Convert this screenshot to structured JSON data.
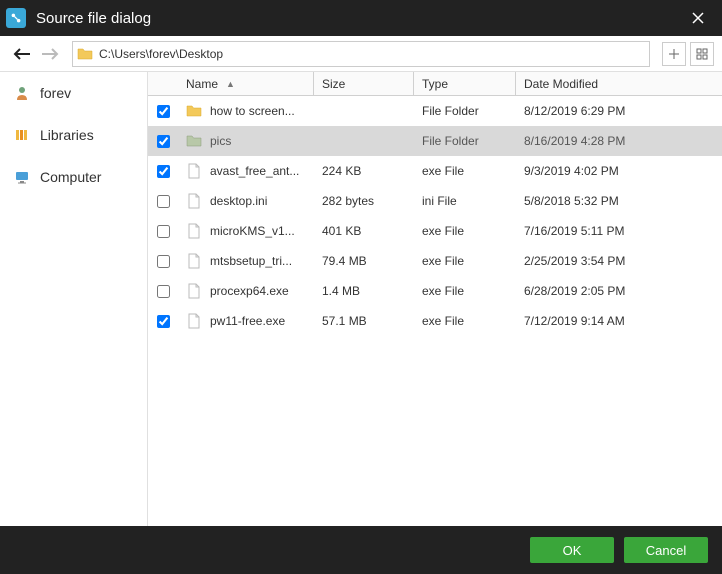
{
  "title": "Source file dialog",
  "path": "C:\\Users\\forev\\Desktop",
  "sidebar": {
    "items": [
      {
        "label": "forev",
        "iconColor": "#6fa27a"
      },
      {
        "label": "Libraries",
        "iconColor": "#f0b840"
      },
      {
        "label": "Computer",
        "iconColor": "#4a9fd8"
      }
    ]
  },
  "columns": {
    "name": "Name",
    "size": "Size",
    "type": "Type",
    "modified": "Date Modified"
  },
  "files": [
    {
      "checked": true,
      "kind": "folder",
      "name": "how to screen...",
      "size": "",
      "type": "File Folder",
      "modified": "8/12/2019 6:29 PM",
      "selected": false
    },
    {
      "checked": true,
      "kind": "folder",
      "name": "pics",
      "size": "",
      "type": "File Folder",
      "modified": "8/16/2019 4:28 PM",
      "selected": true
    },
    {
      "checked": true,
      "kind": "file",
      "name": "avast_free_ant...",
      "size": "224 KB",
      "type": "exe File",
      "modified": "9/3/2019 4:02 PM",
      "selected": false
    },
    {
      "checked": false,
      "kind": "file",
      "name": "desktop.ini",
      "size": "282 bytes",
      "type": "ini File",
      "modified": "5/8/2018 5:32 PM",
      "selected": false
    },
    {
      "checked": false,
      "kind": "file",
      "name": "microKMS_v1...",
      "size": "401 KB",
      "type": "exe File",
      "modified": "7/16/2019 5:11 PM",
      "selected": false
    },
    {
      "checked": false,
      "kind": "file",
      "name": "mtsbsetup_tri...",
      "size": "79.4 MB",
      "type": "exe File",
      "modified": "2/25/2019 3:54 PM",
      "selected": false
    },
    {
      "checked": false,
      "kind": "file",
      "name": "procexp64.exe",
      "size": "1.4 MB",
      "type": "exe File",
      "modified": "6/28/2019 2:05 PM",
      "selected": false
    },
    {
      "checked": true,
      "kind": "file",
      "name": "pw11-free.exe",
      "size": "57.1 MB",
      "type": "exe File",
      "modified": "7/12/2019 9:14 AM",
      "selected": false
    }
  ],
  "buttons": {
    "ok": "OK",
    "cancel": "Cancel"
  }
}
